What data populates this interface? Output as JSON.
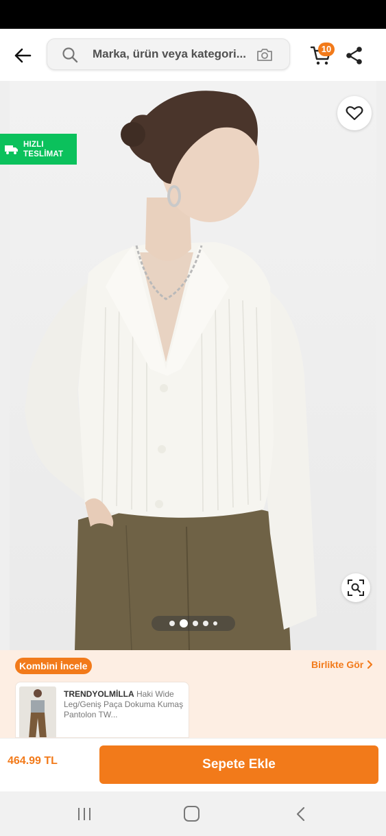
{
  "search": {
    "placeholder": "Marka, ürün veya kategori..."
  },
  "header": {
    "cart_count": "10"
  },
  "gallery": {
    "fast_delivery_line1": "HIZLI",
    "fast_delivery_line2": "TESLİMAT",
    "image_count": 5,
    "active_index": 1
  },
  "combine": {
    "badge_label": "Kombini İncele",
    "see_together_label": "Birlikte Gör",
    "item": {
      "brand": "TRENDYOLMİLLA",
      "title": "Haki Wide Leg/Geniş Paça Dokuma Kumaş Pantolon TW..."
    }
  },
  "footer": {
    "price": "464.99 TL",
    "add_to_cart_label": "Sepete Ekle"
  },
  "colors": {
    "brand": "#f27a1a",
    "fast_delivery": "#0bc15c",
    "combine_bg": "#fdeee3"
  },
  "icons": [
    "arrow-left-icon",
    "search-icon",
    "camera-icon",
    "cart-icon",
    "share-icon",
    "heart-icon",
    "truck-icon",
    "visual-search-icon",
    "chevron-right-icon"
  ]
}
